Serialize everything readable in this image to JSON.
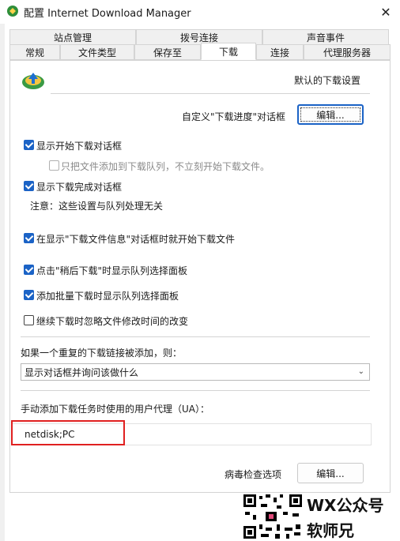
{
  "window": {
    "title": "配置 Internet Download Manager",
    "close_glyph": "✕"
  },
  "tabs": {
    "row1": [
      "站点管理",
      "拨号连接",
      "声音事件"
    ],
    "row2": [
      "常规",
      "文件类型",
      "保存至",
      "下载",
      "连接",
      "代理服务器"
    ],
    "active": "下载"
  },
  "download": {
    "header_label": "默认的下载设置",
    "progress_dialog_label": "自定义\"下载进度\"对话框",
    "edit_button": "编辑...",
    "opt_show_start": {
      "label": "显示开始下载对话框",
      "checked": true
    },
    "opt_only_add_queue": {
      "label": "只把文件添加到下载队列，不立刻开始下载文件。",
      "checked": false,
      "disabled": true
    },
    "opt_show_complete": {
      "label": "显示下载完成对话框",
      "checked": true
    },
    "note": "注意：这些设置与队列处理无关",
    "opt_start_immediately": {
      "label": "在显示\"下载文件信息\"对话框时就开始下载文件",
      "checked": true
    },
    "opt_later_queue": {
      "label": "点击\"稍后下载\"时显示队列选择面板",
      "checked": true
    },
    "opt_batch_queue": {
      "label": "添加批量下载时显示队列选择面板",
      "checked": true
    },
    "opt_ignore_mtime": {
      "label": "继续下载时忽略文件修改时间的改变",
      "checked": false
    },
    "duplicate_label": "如果一个重复的下载链接被添加，则：",
    "duplicate_selected": "显示对话框并询问该做什么",
    "ua_label": "手动添加下载任务时使用的用户代理（UA）：",
    "ua_value": "netdisk;PC",
    "virus_label": "病毒检查选项",
    "virus_button": "编辑..."
  },
  "watermark": {
    "line1": "WX公众号",
    "line2": "软师兄"
  },
  "colors": {
    "accent": "#1b63c6",
    "highlight": "#e02020"
  }
}
